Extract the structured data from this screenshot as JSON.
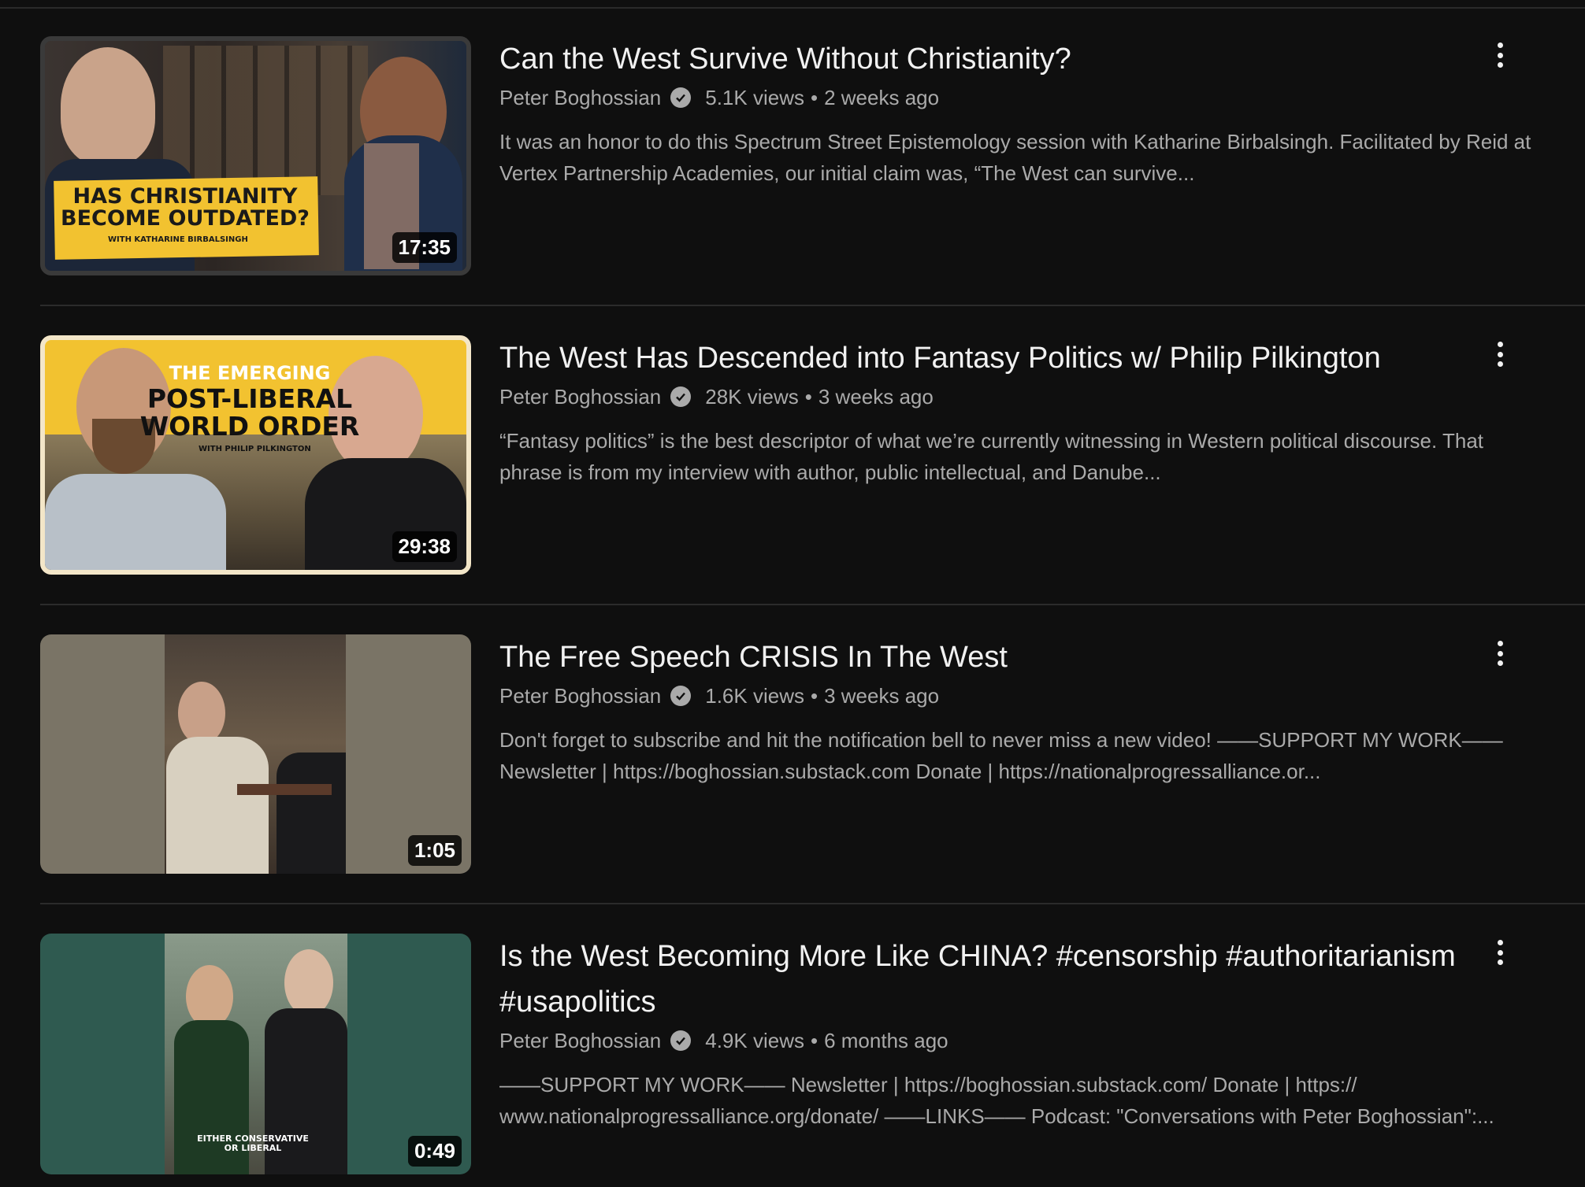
{
  "videos": [
    {
      "title": "Can the West Survive Without Christianity?",
      "channel": "Peter Boghossian",
      "views": "5.1K views",
      "age": "2 weeks ago",
      "description": "It was an honor to do this Spectrum Street Epistemology session with Katharine Birbalsingh. Facilitated by Reid at Vertex Partnership Academies, our initial claim was, “The West can survive...",
      "duration": "17:35",
      "thumb_text": "HAS CHRISTIANITY BECOME OUTDATED?",
      "thumb_sub": "WITH KATHARINE BIRBALSINGH"
    },
    {
      "title": "The West Has Descended into Fantasy Politics w/ Philip Pilkington",
      "channel": "Peter Boghossian",
      "views": "28K views",
      "age": "3 weeks ago",
      "description": "“Fantasy politics” is the best descriptor of what we’re currently witnessing in Western political discourse. That phrase is from my interview with author, public intellectual, and Danube...",
      "duration": "29:38",
      "thumb_text_top": "THE EMERGING",
      "thumb_text": "POST-LIBERAL WORLD ORDER",
      "thumb_sub": "WITH PHILIP PILKINGTON"
    },
    {
      "title": "The Free Speech CRISIS In The West",
      "channel": "Peter Boghossian",
      "views": "1.6K views",
      "age": "3 weeks ago",
      "description": "Don't forget to subscribe and hit the notification bell to never miss a new video! ——SUPPORT MY WORK—— Newsletter | https://boghossian.substack.com Donate | https://nationalprogressalliance.or...",
      "duration": "1:05"
    },
    {
      "title": "Is the West Becoming More Like CHINA? #censorship #authoritarianism #usapolitics",
      "channel": "Peter Boghossian",
      "views": "4.9K views",
      "age": "6 months ago",
      "description": "——SUPPORT MY WORK—— Newsletter | https://boghossian.substack.com/ Donate | https:// www.nationalprogressalliance.org/donate/ ——LINKS—— Podcast: \"Conversations with Peter Boghossian\":...",
      "duration": "0:49",
      "thumb_text": "EITHER CONSERVATIVE OR LIBERAL"
    }
  ],
  "icons": {
    "verified": "verified-check-icon",
    "menu": "more-vertical-icon"
  },
  "colors": {
    "background": "#0f0f0f",
    "primary_text": "#f1f1f1",
    "secondary_text": "#aaaaaa",
    "thumb1_banner": "#f2c230",
    "thumb2_bg": "#f2c230"
  }
}
